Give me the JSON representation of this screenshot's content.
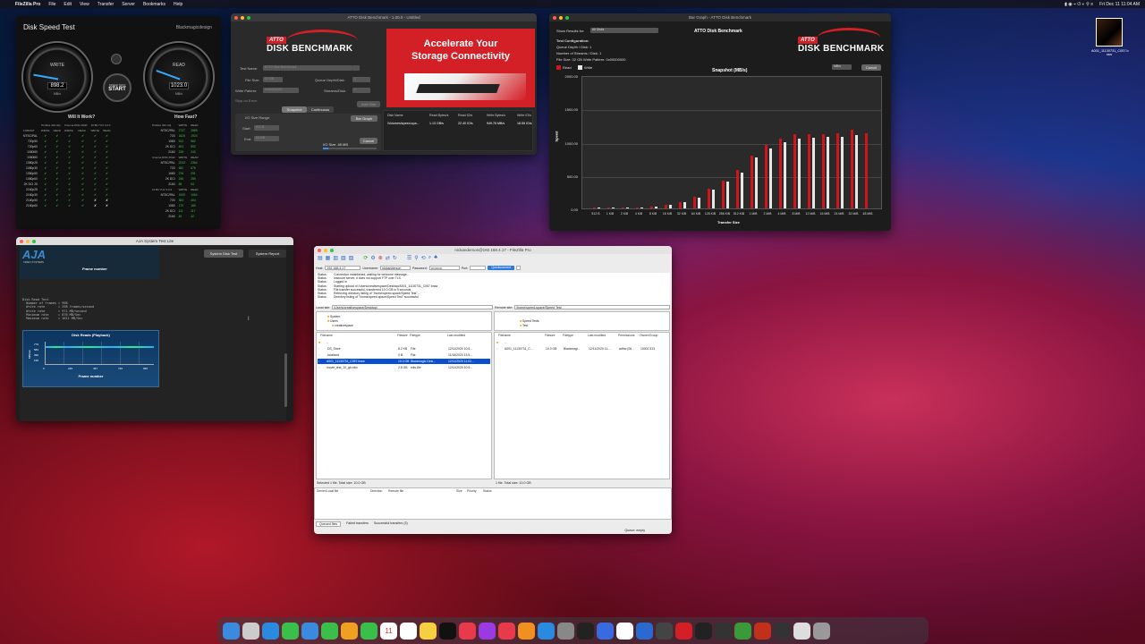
{
  "menubar": {
    "app": "FileZilla Pro",
    "items": [
      "File",
      "Edit",
      "View",
      "Transfer",
      "Server",
      "Bookmarks",
      "Help"
    ],
    "clock": "Fri Dec 11  11:04 AM"
  },
  "desktop_icon": {
    "label1": "A001_11130731_C057.b",
    "label2": "raw"
  },
  "disk_speed": {
    "title": "Disk Speed Test",
    "brand": "Blackmagicdesign",
    "write_label": "WRITE",
    "write_value": "898.2",
    "write_unit": "MB/s",
    "read_label": "READ",
    "read_value": "1023.0",
    "read_unit": "MB/s",
    "start_small": "SPEED TEST",
    "start_big": "START",
    "will_it_work": "Will It Work?",
    "how_fast": "How Fast?",
    "col_groups": [
      "ProRes 422 HQ",
      "Cinema DNG RAW",
      "10 Bit YUV 4:2:2"
    ],
    "rw": [
      "WRITE",
      "READ"
    ],
    "format_head": "FORMAT",
    "formats": [
      "NTSC/PAL",
      "720p50",
      "720p60",
      "1080i50",
      "1080i60",
      "1080p25",
      "1080p30",
      "1080p50",
      "1080p60",
      "2K DCI 25",
      "2160p25",
      "2160p30",
      "2160p50",
      "2160p60"
    ],
    "marks": [
      [
        "✔",
        "✔",
        "✔",
        "✔",
        "✔",
        "✔"
      ],
      [
        "✔",
        "✔",
        "✔",
        "✔",
        "✔",
        "✔"
      ],
      [
        "✔",
        "✔",
        "✔",
        "✔",
        "✔",
        "✔"
      ],
      [
        "✔",
        "✔",
        "✔",
        "✔",
        "✔",
        "✔"
      ],
      [
        "✔",
        "✔",
        "✔",
        "✔",
        "✔",
        "✔"
      ],
      [
        "✔",
        "✔",
        "✔",
        "✔",
        "✔",
        "✔"
      ],
      [
        "✔",
        "✔",
        "✔",
        "✔",
        "✔",
        "✔"
      ],
      [
        "✔",
        "✔",
        "✔",
        "✔",
        "✔",
        "✔"
      ],
      [
        "✔",
        "✔",
        "✔",
        "✔",
        "✔",
        "✔"
      ],
      [
        "✔",
        "✔",
        "✔",
        "✔",
        "✔",
        "✔"
      ],
      [
        "✔",
        "✔",
        "✔",
        "✔",
        "✔",
        "✔"
      ],
      [
        "✔",
        "✔",
        "✔",
        "✔",
        "✔",
        "✔"
      ],
      [
        "✔",
        "✔",
        "✔",
        "✔",
        "✘",
        "✘"
      ],
      [
        "✔",
        "✔",
        "✔",
        "✔",
        "✘",
        "✘"
      ]
    ],
    "fast_groups": [
      {
        "name": "ProRes 422 HQ",
        "rows": [
          [
            "NTSC/PAL",
            "2737",
            "2885"
          ],
          [
            "720",
            "1825",
            "1924"
          ],
          [
            "1080",
            "912",
            "962"
          ],
          [
            "2K DCI",
            "803",
            "892"
          ],
          [
            "2160",
            "228",
            "240"
          ]
        ]
      },
      {
        "name": "Cinema DNG RAW",
        "rows": [
          [
            "NTSC/PAL",
            "2243",
            "2364"
          ],
          [
            "720",
            "652",
            "676"
          ],
          [
            "1080",
            "276",
            "291"
          ],
          [
            "2K DCI",
            "246",
            "259"
          ],
          [
            "2160",
            "89",
            "94"
          ]
        ]
      },
      {
        "name": "10 Bit YUV 4:2:2",
        "rows": [
          [
            "NTSC/PAL",
            "1009",
            "1064"
          ],
          [
            "720",
            "383",
            "404"
          ],
          [
            "1080",
            "170",
            "180"
          ],
          [
            "2K DCI",
            "111",
            "117"
          ],
          [
            "2160",
            "40",
            "42"
          ]
        ]
      }
    ]
  },
  "atto": {
    "title": "ATTO Disk Benchmark - 1.00.0 - Untitled",
    "logo_badge": "ATTO",
    "logo_name": "DISK BENCHMARK",
    "ad_line1": "Accelerate Your",
    "ad_line2": "Storage Connectivity",
    "test_name_label": "Test Name:",
    "test_name_value": "ATTO Disk Benchmark",
    "file_size_label": "File Size:",
    "file_size_value": "32 GB",
    "queue_label": "Queue Depth/Disk:",
    "queue_value": "1",
    "write_pattern_label": "Write Pattern:",
    "write_pattern_value": "0x00000000",
    "streams_label": "Streams/Disk:",
    "streams_value": "1",
    "stop_error": "Stop on Error:",
    "add_disk": "Add Disk",
    "tab_snapshot": "Snapshot",
    "tab_continuous": "Continuous",
    "io_range": "I/O Size Range:",
    "start_label": "Start:",
    "start_value": "512 B",
    "end_label": "End:",
    "end_value": "64 MB",
    "bar_graph_btn": "Bar Graph",
    "cancel_btn": "Cancel",
    "io_size": "I/O Size: 48 MB",
    "res_headers": [
      "Disk Name",
      "Read Bytes/s",
      "Read IO/s",
      "Write Bytes/s",
      "Write IO/s"
    ],
    "res_row": [
      "/Volumes/speed-spa...",
      "1.13 GB/s",
      "22.40 IO/s",
      "949.76 MB/s",
      "18.55 IO/s"
    ]
  },
  "bargraph": {
    "title": "Bar Graph - ATTO Disk Benchmark",
    "show_results_label": "Show Results for:",
    "show_results_value": "All Disks",
    "header": "ATTO Disk Benchmark",
    "config_title": "Test Configuration:",
    "config_lines": [
      "Queue Depth / Disk: 1",
      "Number of Streams / Disk: 1",
      "File Size: 32 GB   Write Pattern: 0x00000000"
    ],
    "legend_read": "Read",
    "legend_write": "Write",
    "units": "MB/s",
    "cancel": "Cancel",
    "logo_badge": "ATTO",
    "logo_name": "DISK BENCHMARK"
  },
  "chart_data": {
    "type": "bar",
    "title": "Snapshot (MB/s)",
    "xlabel": "Transfer Size",
    "ylabel": "Speed",
    "ylim": [
      0,
      2000
    ],
    "yticks": [
      "2000.00",
      "1500.00",
      "1000.00",
      "500.00",
      "0.00"
    ],
    "categories": [
      "512 B",
      "1 KiB",
      "2 KiB",
      "4 KiB",
      "8 KiB",
      "16 KiB",
      "32 KiB",
      "64 KiB",
      "128 KiB",
      "256 KiB",
      "512 KiB",
      "1 MiB",
      "2 MiB",
      "4 MiB",
      "8 MiB",
      "12 MiB",
      "16 MiB",
      "24 MiB",
      "32 MiB",
      "48 MiB"
    ],
    "series": [
      {
        "name": "Read",
        "color": "#d0141c",
        "values": [
          3,
          6,
          10,
          18,
          30,
          55,
          100,
          170,
          300,
          420,
          580,
          790,
          950,
          1050,
          1110,
          1110,
          1120,
          1130,
          1180,
          1130
        ]
      },
      {
        "name": "Write",
        "color": "#e6e6e6",
        "values": [
          2,
          5,
          9,
          16,
          27,
          50,
          90,
          160,
          280,
          400,
          540,
          760,
          900,
          1000,
          1050,
          1060,
          1070,
          1080,
          1100,
          0
        ]
      }
    ]
  },
  "aja": {
    "title": "AJA System Test Lite",
    "logo": "AJA",
    "logo_sub": "VIDEO SYSTEMS",
    "btn_disk": "System Disk Test",
    "btn_report": "System Report",
    "frame_number": "Frame number",
    "terminal": "Disk Read Test\n  Number of frames = 998\n  Write rate       = 298 frames/second\n  Write rate       = 971 MB/second\n  Minimum rate     = 876 MB/Sec\n  Maximum rate     = 1011 MB/Sec",
    "chart_title": "Disk Reads (Playback)",
    "chart_ylabel": "MB/sec",
    "yt": [
      "779",
      "584",
      "390",
      "195"
    ],
    "xt": [
      "0",
      "249",
      "497",
      "746",
      "995"
    ],
    "chart_xlabel": "Frame number"
  },
  "fz": {
    "title": "nickanderson@192.168.4.17 - FileZilla Pro",
    "host_label": "Host:",
    "host": "192.168.4.17",
    "user_label": "Username:",
    "user": "nickanderson",
    "pass_label": "Password:",
    "pass": "••••••••••",
    "port_label": "Port:",
    "quickconnect": "Quickconnect",
    "log": [
      [
        "Status:",
        "Connection established, waiting for welcome message..."
      ],
      [
        "Status:",
        "Insecure server, it does not support FTP over TLS."
      ],
      [
        "Status:",
        "Logged in"
      ],
      [
        "Status:",
        "Starting upload of /Users/creativespace/Desktop/A001_11130731_C057.braw"
      ],
      [
        "Status:",
        "File transfer successful, transferred 10.0 GB in 9 seconds"
      ],
      [
        "Status:",
        "Retrieving directory listing of \"/home/speed-space/Speed Test\"..."
      ],
      [
        "Status:",
        "Directory listing of \"/home/speed-space/Speed Test\" successful"
      ]
    ],
    "local_label": "Local site:",
    "local_path": "/Users/creativespace/Desktop/",
    "remote_label": "Remote site:",
    "remote_path": "/home/speed-space/Speed Test",
    "local_tree": [
      "System",
      "Users",
      "creativespace"
    ],
    "remote_tree": [
      "Speed Tests",
      "Test"
    ],
    "local_cols": [
      "Filename",
      "Filesize",
      "Filetype",
      "Last modified"
    ],
    "local_files": [
      [
        "..",
        "",
        "",
        ""
      ],
      [
        ".DS_Store",
        "8.2 KB",
        "File",
        "12/11/2020 10:5..."
      ],
      [
        ".localized",
        "0 B",
        "File",
        "11/16/2020 13:5..."
      ],
      [
        "A001_11130731_C057.braw",
        "10.0 GB",
        "Blackmagic Desi...",
        "12/11/2020 11:02..."
      ],
      [
        "movie_test_10_gb.mkv",
        "2.8 GB",
        "mkv-file",
        "12/11/2020 10:5..."
      ]
    ],
    "remote_cols": [
      "Filename",
      "Filesize",
      "Filetype",
      "Last modified",
      "Permissions",
      "Owner/Group"
    ],
    "remote_files": [
      [
        "..",
        "",
        "",
        "",
        "",
        ""
      ],
      [
        "A001_11130731_C...",
        "10.0 GB",
        "Blackmagi...",
        "12/11/2020 11:...",
        "adfrw (06...",
        "10002 513"
      ]
    ],
    "local_status": "Selected 1 file. Total size: 10.0 GB",
    "remote_status": "1 file. Total size: 10.0 GB",
    "queue_cols": [
      "Server/Local file",
      "Direction",
      "Remote file",
      "Size",
      "Priority",
      "Status"
    ],
    "tabs": [
      "Queued files",
      "Failed transfers",
      "Successful transfers (3)"
    ],
    "queue_status": "Queue: empty"
  },
  "dock": [
    "Finder",
    "Launchpad",
    "Safari",
    "Messages",
    "Mail",
    "Maps",
    "Photos",
    "FaceTime",
    "11",
    "Reminders",
    "Notes",
    "TV",
    "Music",
    "Podcasts",
    "News",
    "Pages",
    "App Store",
    "System Preferences",
    "DaVinci",
    "Cardhop",
    "Slack",
    "Hopper",
    "Camo",
    "ATTO",
    "Activity",
    "Console",
    "FileZilla",
    "FileZilla Pro",
    "Preview",
    "Finder2",
    "Trash"
  ]
}
